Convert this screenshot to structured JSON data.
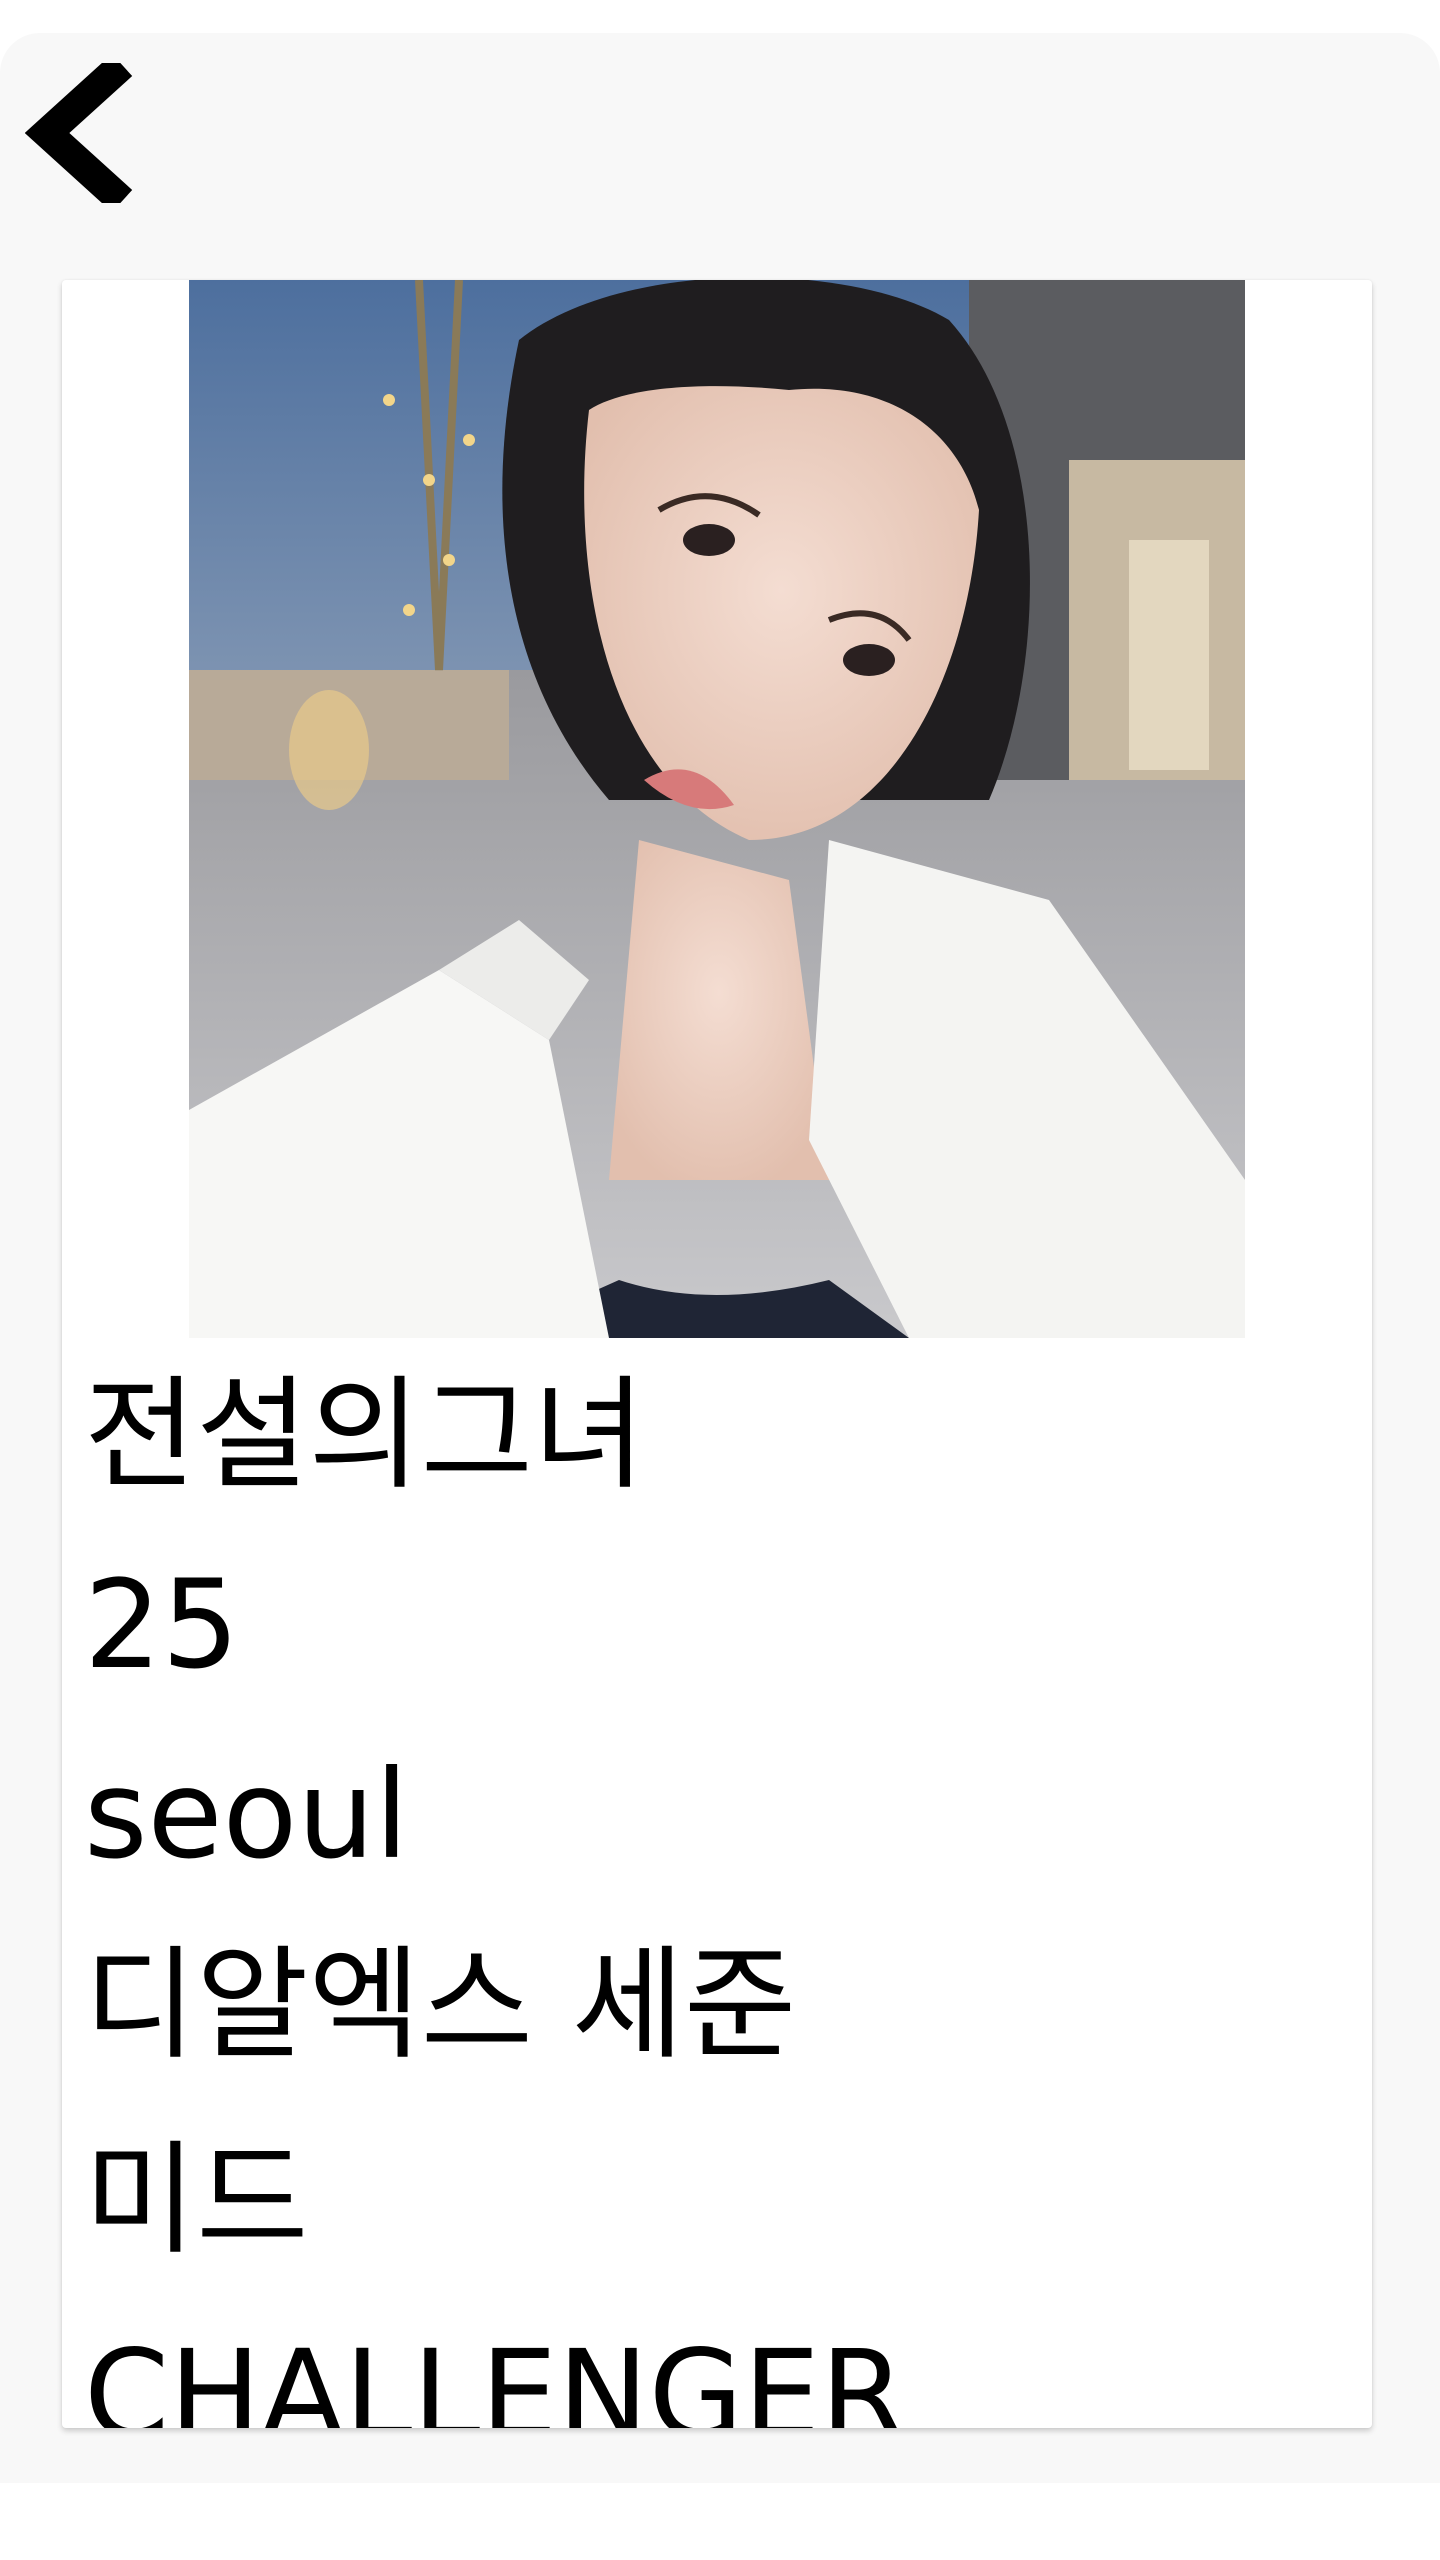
{
  "nav": {
    "back_icon": "chevron-left-icon"
  },
  "profile": {
    "photo_alt": "",
    "nickname": "전설의그녀",
    "age": "25",
    "location": "seoul",
    "favorite_team": "디알엑스 세준",
    "position": "미드",
    "tier": "CHALLENGER"
  },
  "colors": {
    "background": "#f8f8f8",
    "card": "#ffffff",
    "text": "#000000"
  }
}
